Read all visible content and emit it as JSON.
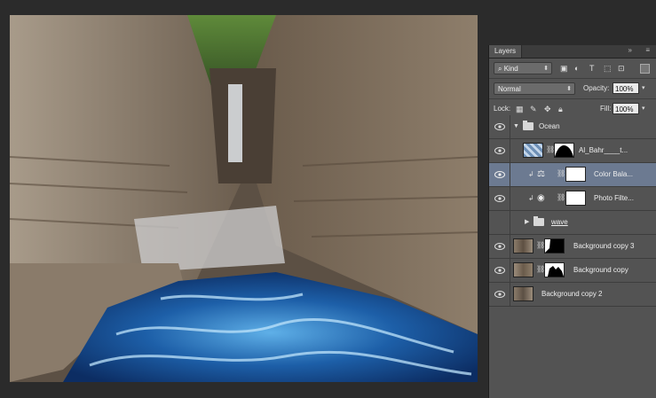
{
  "panel": {
    "tab": "Layers",
    "filter_kind": "Kind",
    "blend_mode": "Normal",
    "opacity_label": "Opacity:",
    "opacity": "100%",
    "lock_label": "Lock:",
    "fill_label": "Fill:",
    "fill": "100%"
  },
  "layers": [
    {
      "name": "Ocean",
      "type": "group",
      "visible": true
    },
    {
      "name": "Al_Bahr____t...",
      "type": "layer-with-mask",
      "visible": true
    },
    {
      "name": "Color Bala...",
      "type": "adjustment",
      "visible": true,
      "selected": true
    },
    {
      "name": "Photo Filte...",
      "type": "adjustment",
      "visible": true
    },
    {
      "name": "wave",
      "type": "group",
      "visible": true
    },
    {
      "name": "Background copy 3",
      "type": "layer-with-mask",
      "visible": true
    },
    {
      "name": "Background copy",
      "type": "layer-with-mask",
      "visible": true
    },
    {
      "name": "Background copy 2",
      "type": "layer",
      "visible": true
    }
  ],
  "colors": {
    "panel_bg": "#535353",
    "selected_row": "#6c7a91",
    "app_bg": "#2b2b2b",
    "water_blue": "#1d5fa8"
  }
}
